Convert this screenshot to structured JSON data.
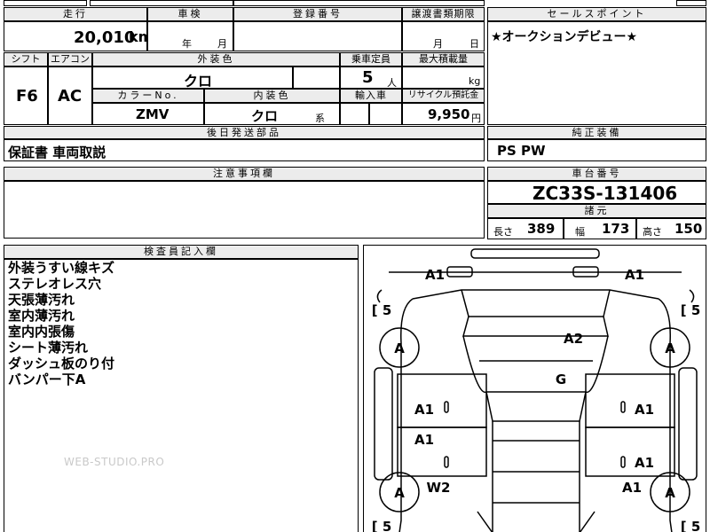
{
  "top_row": {
    "mileage_label": "走行",
    "shaken_label": "車検",
    "registration_label": "登録番号",
    "transfer_deadline_label": "譲渡書類期限",
    "sales_point_label": "セールスポイント"
  },
  "mileage": {
    "value": "20,010",
    "unit": "km"
  },
  "shaken": {
    "year_unit": "年",
    "month_unit": "月"
  },
  "transfer": {
    "month_unit": "月",
    "day_unit": "日"
  },
  "sales_point": {
    "text": "★オークションデビュー★"
  },
  "row2": {
    "shift_label": "シフト",
    "aircon_label": "エアコン",
    "exterior_color_label": "外装色",
    "capacity_label": "乗車定員",
    "max_load_label": "最大積載量",
    "shift_value": "F6",
    "aircon_value": "AC",
    "exterior_color_value": "クロ",
    "capacity_value": "5",
    "capacity_unit": "人",
    "max_load_unit": "kg",
    "color_no_label": "カラーNo.",
    "interior_color_label": "内装色",
    "import_label": "輸入車",
    "recycle_label": "リサイクル預託金",
    "color_no_value": "ZMV",
    "interior_color_value": "クロ",
    "interior_color_suffix": "系",
    "recycle_value": "9,950",
    "recycle_unit": "円"
  },
  "later_parts": {
    "label": "後日発送部品",
    "value": "保証書 車両取説"
  },
  "genuine_equipment": {
    "label": "純正装備",
    "value": "PS PW"
  },
  "notes": {
    "label": "注意事項欄"
  },
  "chassis": {
    "label": "車台番号",
    "value": "ZC33S-131406"
  },
  "dimensions": {
    "label": "諸元",
    "length_label": "長さ",
    "length_value": "389",
    "width_label": "幅",
    "width_value": "173",
    "height_label": "高さ",
    "height_value": "150"
  },
  "inspector": {
    "label": "検査員記入欄",
    "lines": [
      "外装うすい線キズ",
      "ステレオレス穴",
      "天張薄汚れ",
      "室内薄汚れ",
      "室内内張傷",
      "シート薄汚れ",
      "ダッシュ板のり付",
      "バンパー下A"
    ]
  },
  "watermark": "WEB-STUDIO.PRO",
  "diagram": {
    "marks": {
      "front_left": "A1",
      "front_right": "A1",
      "tire_rating": "5",
      "wheel_a": "A",
      "roof": "A2",
      "rear_glass": "G",
      "door_fl": "A1",
      "door_fr": "A1",
      "door_rl": "A1",
      "door_rr": "A1",
      "fender_rl": "W2",
      "fender_rr": "A1"
    }
  }
}
